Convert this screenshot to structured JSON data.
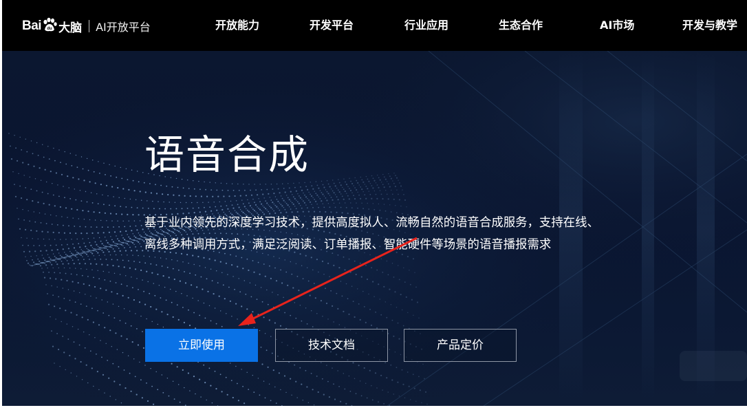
{
  "brand": {
    "bai": "Bai",
    "dunao": "大脑",
    "subtitle": "AI开放平台",
    "accent": "#0a72e6"
  },
  "nav": {
    "items": [
      "开放能力",
      "开发平台",
      "行业应用",
      "生态合作",
      "AI市场",
      "开发与教学"
    ]
  },
  "hero": {
    "title": "语音合成",
    "description_line1": "基于业内领先的深度学习技术，提供高度拟人、流畅自然的语音合成服务，支持在线、",
    "description_line2": "离线多种调用方式，满足泛阅读、订单播报、智能硬件等场景的语音播报需求",
    "buttons": {
      "primary": "立即使用",
      "docs": "技术文档",
      "pricing": "产品定价"
    }
  },
  "annotation": {
    "arrow_color": "#e8231c"
  }
}
